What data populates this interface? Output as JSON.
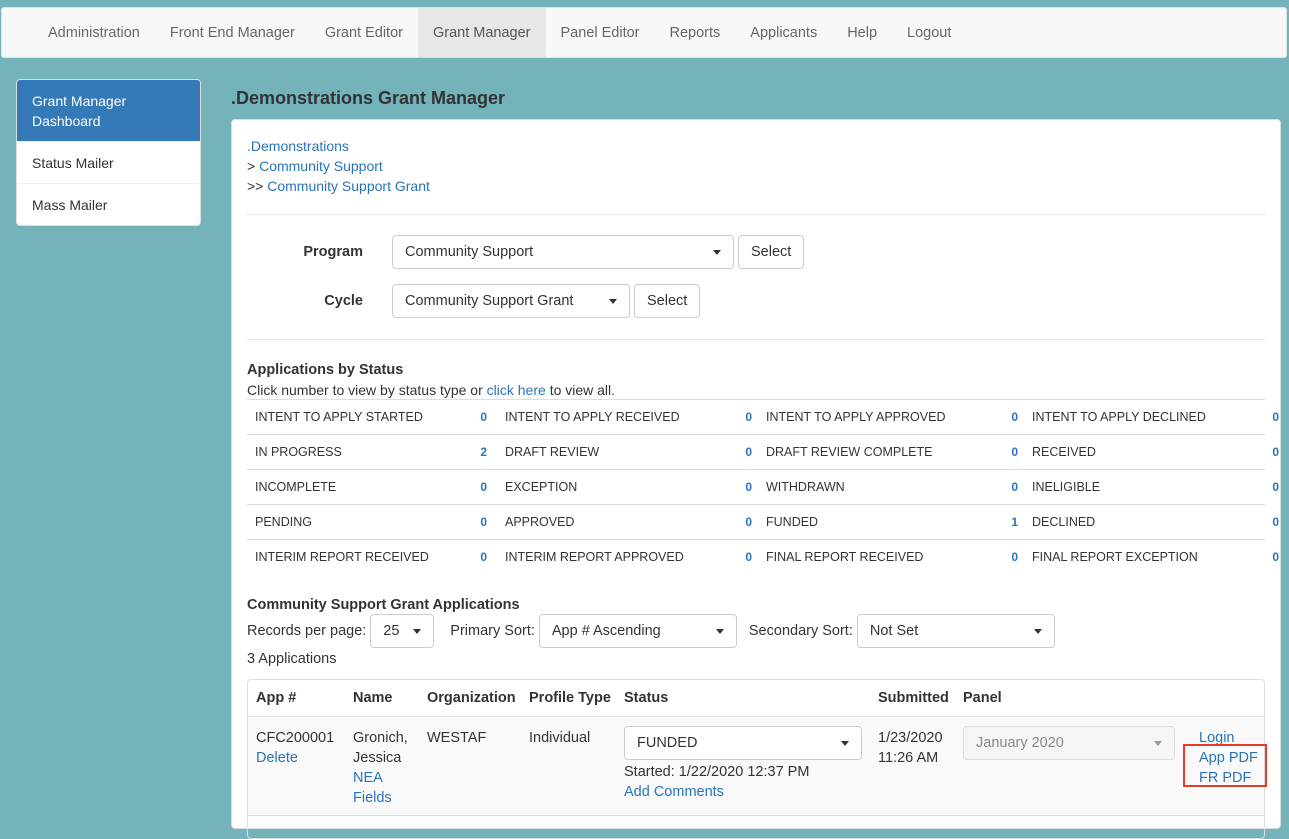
{
  "nav": {
    "items": [
      "Administration",
      "Front End Manager",
      "Grant Editor",
      "Grant Manager",
      "Panel Editor",
      "Reports",
      "Applicants",
      "Help",
      "Logout"
    ],
    "active": "Grant Manager"
  },
  "sidebar": {
    "items": [
      "Grant Manager Dashboard",
      "Status Mailer",
      "Mass Mailer"
    ]
  },
  "page": {
    "title": ".Demonstrations Grant Manager"
  },
  "breadcrumb": {
    "org": ".Demonstrations",
    "program_prefix": ">",
    "program": "Community Support",
    "cycle_prefix": ">>",
    "cycle": "Community Support Grant"
  },
  "filters": {
    "program_label": "Program",
    "program_value": "Community Support",
    "cycle_label": "Cycle",
    "cycle_value": "Community Support Grant",
    "select_label": "Select"
  },
  "status": {
    "title": "Applications by Status",
    "hint_before": "Click number to view by status type or",
    "hint_link": "click here",
    "hint_after": "to view all.",
    "rows": [
      [
        [
          "INTENT TO APPLY STARTED",
          "0"
        ],
        [
          "INTENT TO APPLY RECEIVED",
          "0"
        ],
        [
          "INTENT TO APPLY APPROVED",
          "0"
        ],
        [
          "INTENT TO APPLY DECLINED",
          "0"
        ]
      ],
      [
        [
          "IN PROGRESS",
          "2"
        ],
        [
          "DRAFT REVIEW",
          "0"
        ],
        [
          "DRAFT REVIEW COMPLETE",
          "0"
        ],
        [
          "RECEIVED",
          "0"
        ]
      ],
      [
        [
          "INCOMPLETE",
          "0"
        ],
        [
          "EXCEPTION",
          "0"
        ],
        [
          "WITHDRAWN",
          "0"
        ],
        [
          "INELIGIBLE",
          "0"
        ]
      ],
      [
        [
          "PENDING",
          "0"
        ],
        [
          "APPROVED",
          "0"
        ],
        [
          "FUNDED",
          "1"
        ],
        [
          "DECLINED",
          "0"
        ]
      ],
      [
        [
          "INTERIM REPORT RECEIVED",
          "0"
        ],
        [
          "INTERIM REPORT APPROVED",
          "0"
        ],
        [
          "FINAL REPORT RECEIVED",
          "0"
        ],
        [
          "FINAL REPORT EXCEPTION",
          "0"
        ]
      ]
    ]
  },
  "apps": {
    "title": "Community Support Grant Applications",
    "records_label": "Records per page:",
    "records_value": "25",
    "primary_label": "Primary Sort:",
    "primary_value": "App # Ascending",
    "secondary_label": "Secondary Sort:",
    "secondary_value": "Not Set",
    "count_text": "3 Applications",
    "columns": [
      "App #",
      "Name",
      "Organization",
      "Profile Type",
      "Status",
      "Submitted",
      "Panel"
    ],
    "rows": [
      {
        "app_no": "CFC200001",
        "delete": "Delete",
        "name_line1": "Gronich,",
        "name_line2": "Jessica",
        "nea_line1": "NEA",
        "nea_line2": "Fields",
        "org": "WESTAF",
        "profile": "Individual",
        "status": "FUNDED",
        "started": "Started: 1/22/2020 12:37 PM",
        "add_comments": "Add Comments",
        "submitted_date": "1/23/2020",
        "submitted_time": "11:26 AM",
        "panel": "January 2020",
        "login": "Login",
        "app_pdf": "App PDF",
        "fr_pdf": "FR PDF"
      }
    ]
  },
  "colors": {
    "bg": "#74b3ba",
    "primary": "#337ab7",
    "link": "#2a73b8",
    "highlight": "#e53b2c"
  }
}
